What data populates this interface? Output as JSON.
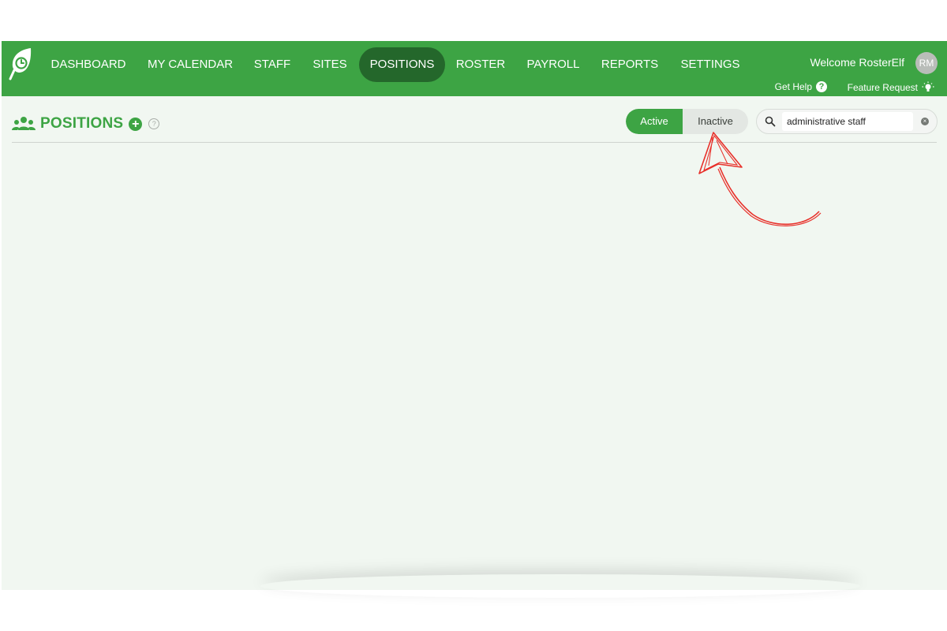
{
  "nav": {
    "items": [
      {
        "label": "DASHBOARD"
      },
      {
        "label": "MY CALENDAR"
      },
      {
        "label": "STAFF"
      },
      {
        "label": "SITES"
      },
      {
        "label": "POSITIONS"
      },
      {
        "label": "ROSTER"
      },
      {
        "label": "PAYROLL"
      },
      {
        "label": "REPORTS"
      },
      {
        "label": "SETTINGS"
      }
    ],
    "active": "POSITIONS"
  },
  "user": {
    "welcome": "Welcome RosterElf",
    "initials": "RM"
  },
  "links": {
    "help": "Get Help",
    "feature": "Feature Request"
  },
  "page": {
    "title": "POSITIONS",
    "filter": {
      "active_label": "Active",
      "inactive_label": "Inactive",
      "selected": "Active"
    },
    "search": {
      "value": "administrative staff"
    }
  },
  "colors": {
    "brand_green": "#3da444",
    "nav_active": "#24672b",
    "annotation_red": "#e8302a"
  },
  "icons": {
    "logo": "leaf-clock-logo",
    "page": "users-group-icon",
    "add": "plus-circle-icon",
    "info": "question-circle-icon",
    "search": "search-icon",
    "clear": "clear-icon",
    "help": "question-icon",
    "feature": "lightbulb-icon"
  }
}
